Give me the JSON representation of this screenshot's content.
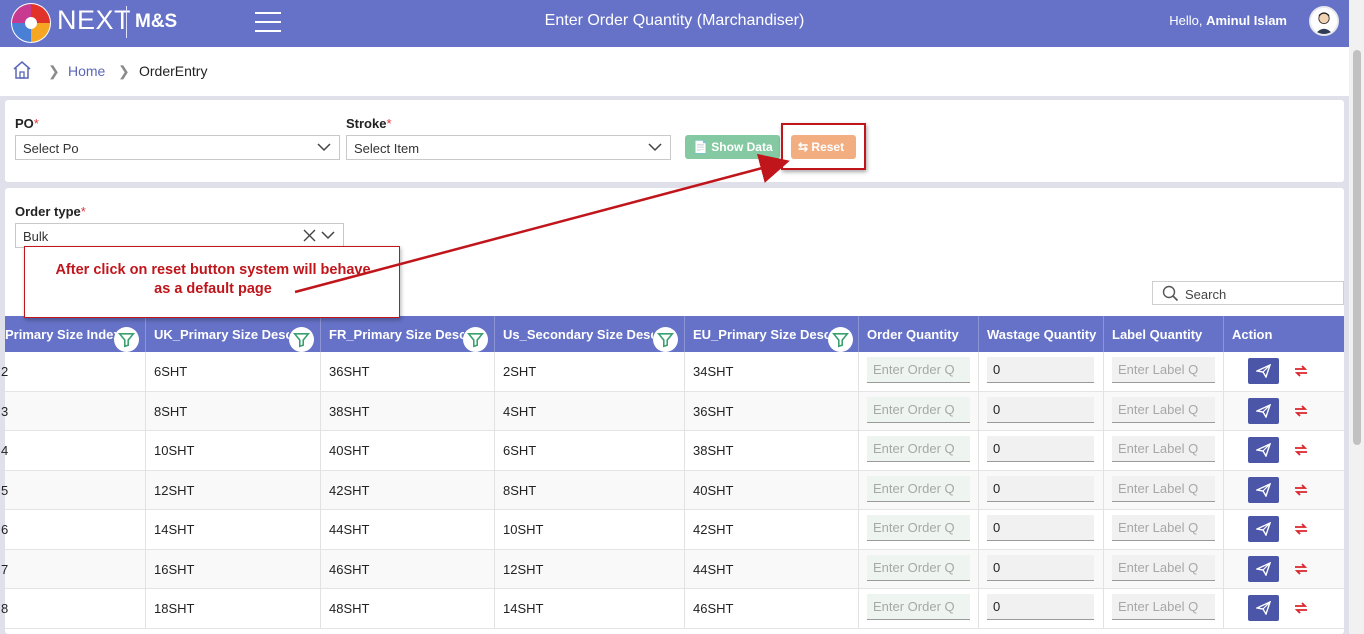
{
  "header": {
    "brand": "NEXT",
    "brand_sub": "M&S",
    "page_title": "Enter Order Quantity (Marchandiser)",
    "greeting": "Hello,",
    "user_name": "Aminul Islam"
  },
  "breadcrumb": {
    "home": "Home",
    "current": "OrderEntry"
  },
  "filters": {
    "po_label": "PO",
    "po_placeholder": "Select Po",
    "stroke_label": "Stroke",
    "stroke_placeholder": "Select Item",
    "required_mark": "*",
    "show_data": "Show Data",
    "reset": "Reset"
  },
  "order_type": {
    "label": "Order type",
    "value": "Bulk"
  },
  "annotation": {
    "line1": "After click on reset button system will behave",
    "line2": "as a default page"
  },
  "search": {
    "placeholder": "Search"
  },
  "table": {
    "columns": [
      "Primary Size Index",
      "UK_Primary Size Desc",
      "FR_Primary Size Desc",
      "Us_Secondary Size Desc",
      "EU_Primary Size Desc",
      "Order Quantity",
      "Wastage Quantity",
      "Label Quantity",
      "Action"
    ],
    "order_placeholder": "Enter Order Q",
    "label_placeholder": "Enter Label Q",
    "rows": [
      {
        "index": "2",
        "uk": "6SHT",
        "fr": "36SHT",
        "us": "2SHT",
        "eu": "34SHT",
        "wastage": "0"
      },
      {
        "index": "3",
        "uk": "8SHT",
        "fr": "38SHT",
        "us": "4SHT",
        "eu": "36SHT",
        "wastage": "0"
      },
      {
        "index": "4",
        "uk": "10SHT",
        "fr": "40SHT",
        "us": "6SHT",
        "eu": "38SHT",
        "wastage": "0"
      },
      {
        "index": "5",
        "uk": "12SHT",
        "fr": "42SHT",
        "us": "8SHT",
        "eu": "40SHT",
        "wastage": "0"
      },
      {
        "index": "6",
        "uk": "14SHT",
        "fr": "44SHT",
        "us": "10SHT",
        "eu": "42SHT",
        "wastage": "0"
      },
      {
        "index": "7",
        "uk": "16SHT",
        "fr": "46SHT",
        "us": "12SHT",
        "eu": "44SHT",
        "wastage": "0"
      },
      {
        "index": "8",
        "uk": "18SHT",
        "fr": "48SHT",
        "us": "14SHT",
        "eu": "46SHT",
        "wastage": "0"
      }
    ]
  },
  "colors": {
    "header_bg": "#6672c7",
    "show_data_bg": "#84c9a2",
    "reset_bg": "#f2ae80",
    "annotation_red": "#c0151b"
  }
}
